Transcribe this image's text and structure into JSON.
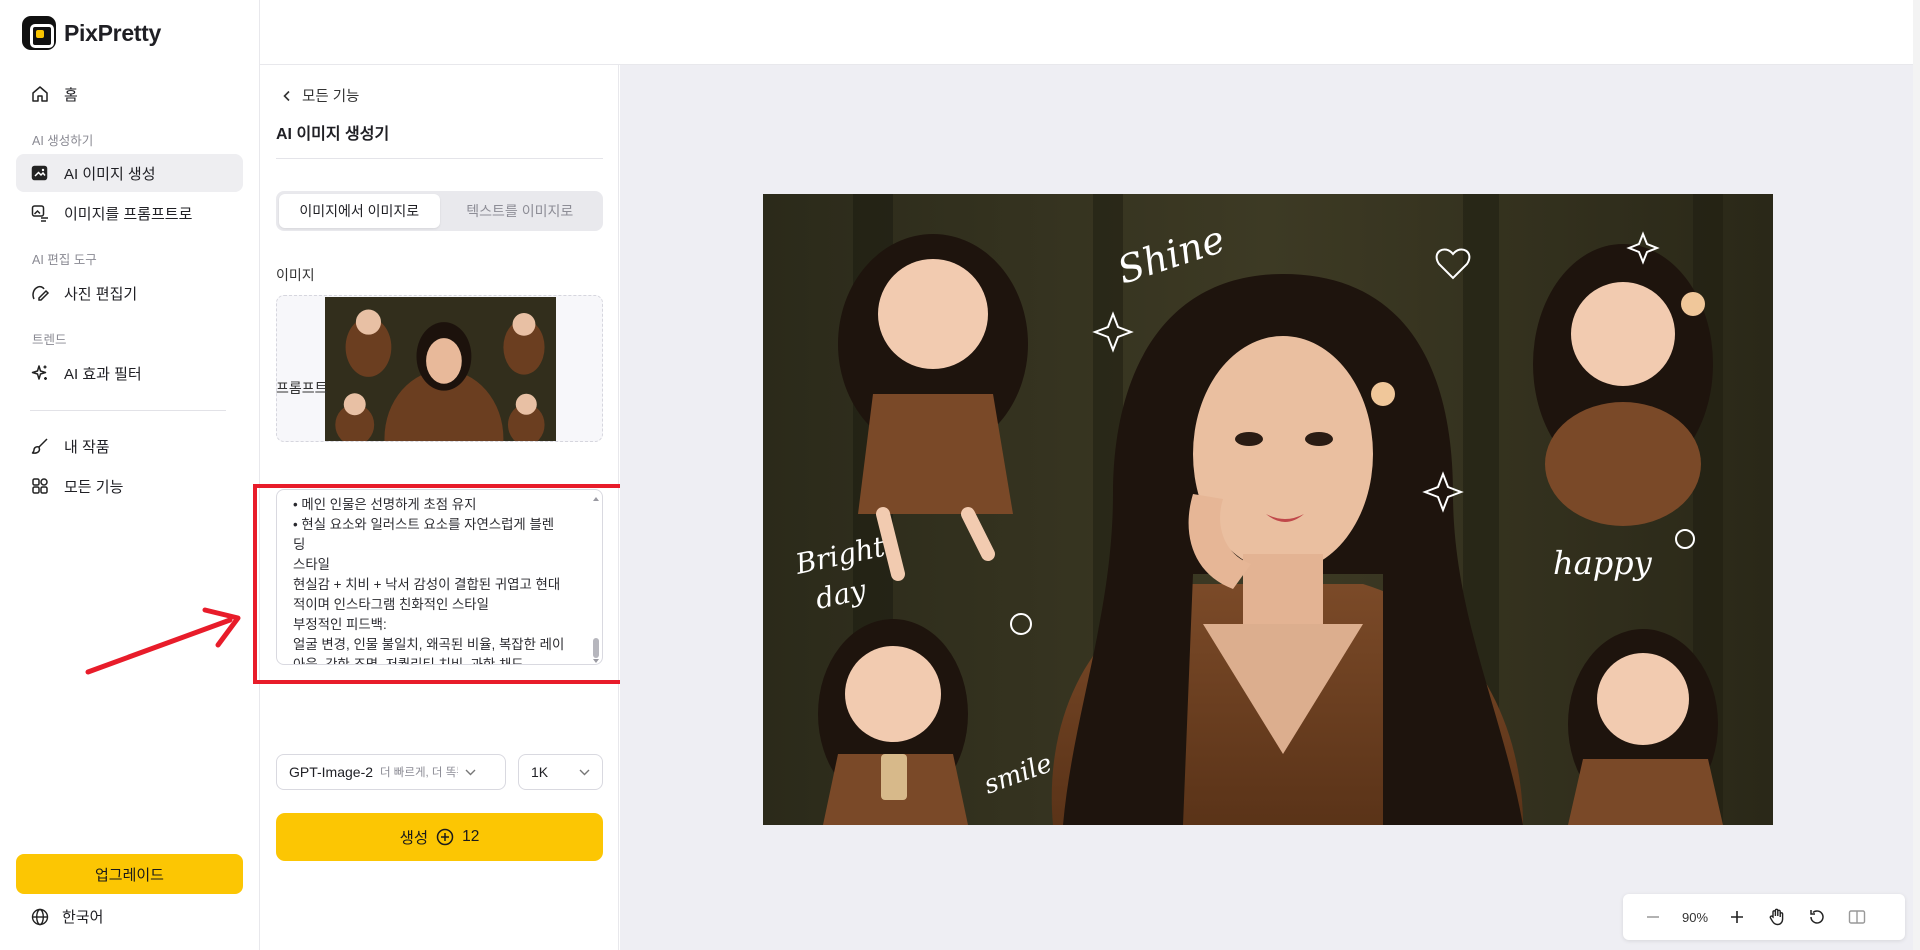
{
  "app": {
    "name": "PixPretty"
  },
  "sidebar": {
    "home": "홈",
    "section_ai_gen": "AI 생성하기",
    "ai_image_gen": "AI 이미지 생성",
    "image_to_prompt": "이미지를 프롬프트로",
    "section_ai_edit": "AI 편집 도구",
    "photo_editor": "사진 편집기",
    "section_trend": "트렌드",
    "ai_effect_filter": "AI 효과 필터",
    "my_works": "내 작품",
    "all_features": "모든 기능",
    "upgrade": "업그레이드",
    "language": "한국어"
  },
  "panel": {
    "back": "모든 기능",
    "title": "AI 이미지 생성기",
    "tab_img2img": "이미지에서 이미지로",
    "tab_txt2img": "텍스트를 이미지로",
    "image_label": "이미지",
    "prompt_label": "프롬프트",
    "prompt_lines": [
      "• 메인 인물은 선명하게 초점 유지",
      "• 현실 요소와 일러스트 요소를 자연스럽게 블렌",
      "딩",
      "스타일",
      "현실감 + 치비 + 낙서 감성이 결합된 귀엽고 현대",
      "적이며 인스타그램 친화적인 스타일",
      "부정적인 피드백:",
      "얼굴 변경, 인물 불일치, 왜곡된 비율, 복잡한 레이",
      "아웃, 강한 조명, 저퀄리티 치비, 과한 채도"
    ],
    "model": "GPT-Image-2",
    "model_hint": "더 빠르게, 더 똑똑하게",
    "resolution": "1K",
    "generate": "생성",
    "credits": "12"
  },
  "preview": {
    "doodles": [
      "Shine",
      "Bright",
      "day",
      "happy",
      "smile"
    ]
  },
  "zoom": {
    "level": "90%"
  },
  "colors": {
    "accent": "#fcc603",
    "annotation": "#e81c2a"
  }
}
